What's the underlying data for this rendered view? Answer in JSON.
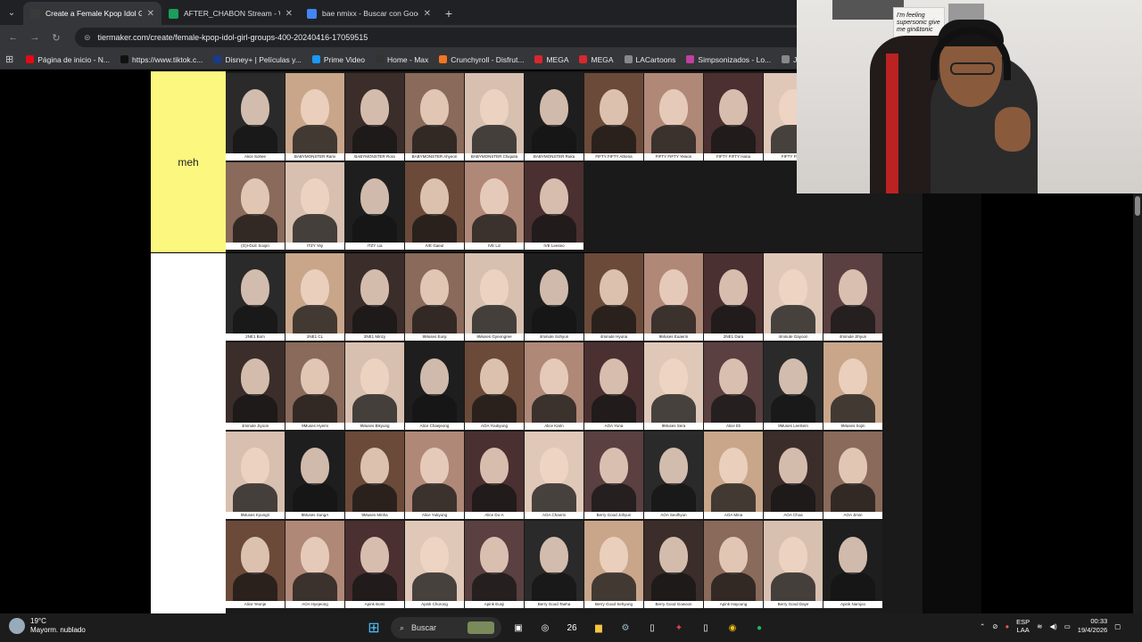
{
  "browser": {
    "tabs": [
      {
        "title": "Create a Female Kpop Idol Girl",
        "active": true,
        "favicon_color": "#3a3a3a"
      },
      {
        "title": "AFTER_CHABON Stream - Watch",
        "active": false,
        "favicon_color": "#1a9e5a"
      },
      {
        "title": "bae nmixx - Buscar con Google",
        "active": false,
        "favicon_color": "#4285f4"
      }
    ],
    "new_tab_label": "+",
    "url": "tiermaker.com/create/female-kpop-idol-girl-groups-400-20240416-17059515",
    "bookmarks": [
      {
        "label": "Página de inicio - N...",
        "color": "#e50914"
      },
      {
        "label": "https://www.tiktok.c...",
        "color": "#111111"
      },
      {
        "label": "Disney+ | Películas y...",
        "color": "#1a3a8a"
      },
      {
        "label": "Prime Video",
        "color": "#1a98ff"
      },
      {
        "label": "Home - Max",
        "color": "#333333"
      },
      {
        "label": "Crunchyroll - Disfrut...",
        "color": "#f47521"
      },
      {
        "label": "MEGA",
        "color": "#d9272e"
      },
      {
        "label": "MEGA",
        "color": "#d9272e"
      },
      {
        "label": "LACartoons",
        "color": "#888888"
      },
      {
        "label": "Simpsonizados - Lo...",
        "color": "#c040a0"
      },
      {
        "label": "Juegos",
        "color": "#888888"
      }
    ]
  },
  "tier_meh": {
    "label": "meh",
    "color": "#fcf77e",
    "row1": [
      "Alice Sohee",
      "BABYMONSTER Rami",
      "BABYMONSTER Rora",
      "BABYMONSTER Ahyeon",
      "BABYMONSTER Chiquita",
      "BABYMONSTER Ruka",
      "FIFTY FIFTY Athena",
      "FIFTY FIFTY Yewon",
      "FIFTY FIFTY Hana",
      "FIFTY FIFTY"
    ],
    "row2": [
      "(G)I-DLE Soojin",
      "ITZY Yeji",
      "ITZY Lia",
      "IVE Gaeul",
      "IVE Liz",
      "IVE Leeseo"
    ]
  },
  "tier_pool": {
    "label": "",
    "rows": [
      [
        "2NE1 Bom",
        "2NE1 CL",
        "2NE1 Minzy",
        "9Muses Eunji",
        "9Muses Gyeongree",
        "4minute Sohyun",
        "4minute Hyuna",
        "9Muses Euaerin",
        "2NE1 Dara",
        "4minute Gayoon",
        "4minute Jihyun"
      ],
      [
        "4minute Jiyoon",
        "9Muses Hyemi",
        "9Muses Bikyung",
        "Alice Chaejeong",
        "AOA Youkyung",
        "Alice Karin",
        "AOA Yuna",
        "9Muses Sera",
        "Alice Eli",
        "9Muses LeeSem",
        "9Muses Sojin"
      ],
      [
        "9Muses Kyungri",
        "9Muses SungA",
        "9Muses Minha",
        "Alice Yukyung",
        "Alice Do-A",
        "AOA Chanmi",
        "Berry Good Johyun",
        "AOA Seolhyun",
        "AOA Mina",
        "AOA Choa",
        "AOA Jimin"
      ],
      [
        "Alice Yeonje",
        "AOA Hyejeong",
        "Apink Bomi",
        "Apink Chorong",
        "Apink Eunji",
        "Berry Good Taeha",
        "Berry Good Sehyung",
        "Berry Good Gowoon",
        "Apink Hayoung",
        "Berry Good Daye",
        "Apink Namjoo"
      ]
    ]
  },
  "webcam": {
    "poster_text": "I'm feeling supersonic give me gin&tonic"
  },
  "taskbar": {
    "weather_temp": "19°C",
    "weather_desc": "Mayorm. nublado",
    "search_label": "Buscar",
    "badge": "26",
    "lang_top": "ESP",
    "lang_bottom": "LAA",
    "time": "00:33",
    "date": "19/4/2026"
  },
  "colors": {
    "tier_meh": "#fcf77e",
    "tier_pool": "#ffffff"
  }
}
